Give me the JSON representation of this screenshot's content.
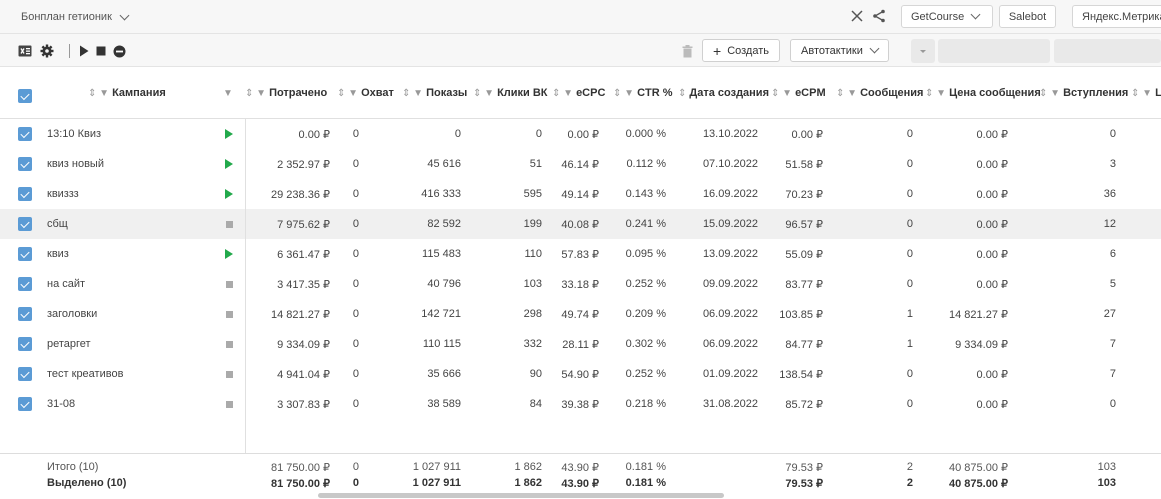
{
  "account": {
    "label": "Бонплан гетионик"
  },
  "top_buttons": [
    "GetCourse",
    "Salebot",
    "Яндекс.Метрика"
  ],
  "toolbar": {
    "create_label": "Создать",
    "autotactics_label": "Автотактики"
  },
  "columns": {
    "campaign": "Кампания",
    "spent": "Потрачено",
    "reach": "Охват",
    "impressions": "Показы",
    "clicks": "Клики ВК",
    "ecpc": "eCPC",
    "ctr": "CTR %",
    "created": "Дата создания",
    "ecpm": "eCPM",
    "messages": "Сообщения",
    "msg_price": "Цена сообщения",
    "joins": "Вступления",
    "extra": "L"
  },
  "rows": [
    {
      "name": "13:10 Квиз",
      "status": "play",
      "spent": "0.00 ₽",
      "reach": "0",
      "impressions": "0",
      "clicks": "0",
      "ecpc": "0.00 ₽",
      "ctr": "0.000 %",
      "created": "13.10.2022",
      "ecpm": "0.00 ₽",
      "messages": "0",
      "msg_price": "0.00 ₽",
      "joins": "0"
    },
    {
      "name": "квиз новый",
      "status": "play",
      "spent": "2 352.97 ₽",
      "reach": "0",
      "impressions": "45 616",
      "clicks": "51",
      "ecpc": "46.14 ₽",
      "ctr": "0.112 %",
      "created": "07.10.2022",
      "ecpm": "51.58 ₽",
      "messages": "0",
      "msg_price": "0.00 ₽",
      "joins": "3"
    },
    {
      "name": "квиззз",
      "status": "play",
      "spent": "29 238.36 ₽",
      "reach": "0",
      "impressions": "416 333",
      "clicks": "595",
      "ecpc": "49.14 ₽",
      "ctr": "0.143 %",
      "created": "16.09.2022",
      "ecpm": "70.23 ₽",
      "messages": "0",
      "msg_price": "0.00 ₽",
      "joins": "36"
    },
    {
      "name": "сбщ",
      "status": "stop",
      "spent": "7 975.62 ₽",
      "reach": "0",
      "impressions": "82 592",
      "clicks": "199",
      "ecpc": "40.08 ₽",
      "ctr": "0.241 %",
      "created": "15.09.2022",
      "ecpm": "96.57 ₽",
      "messages": "0",
      "msg_price": "0.00 ₽",
      "joins": "12"
    },
    {
      "name": "квиз",
      "status": "play",
      "spent": "6 361.47 ₽",
      "reach": "0",
      "impressions": "115 483",
      "clicks": "110",
      "ecpc": "57.83 ₽",
      "ctr": "0.095 %",
      "created": "13.09.2022",
      "ecpm": "55.09 ₽",
      "messages": "0",
      "msg_price": "0.00 ₽",
      "joins": "6"
    },
    {
      "name": "на сайт",
      "status": "stop",
      "spent": "3 417.35 ₽",
      "reach": "0",
      "impressions": "40 796",
      "clicks": "103",
      "ecpc": "33.18 ₽",
      "ctr": "0.252 %",
      "created": "09.09.2022",
      "ecpm": "83.77 ₽",
      "messages": "0",
      "msg_price": "0.00 ₽",
      "joins": "5"
    },
    {
      "name": "заголовки",
      "status": "stop",
      "spent": "14 821.27 ₽",
      "reach": "0",
      "impressions": "142 721",
      "clicks": "298",
      "ecpc": "49.74 ₽",
      "ctr": "0.209 %",
      "created": "06.09.2022",
      "ecpm": "103.85 ₽",
      "messages": "1",
      "msg_price": "14 821.27 ₽",
      "joins": "27"
    },
    {
      "name": "ретаргет",
      "status": "stop",
      "spent": "9 334.09 ₽",
      "reach": "0",
      "impressions": "110 115",
      "clicks": "332",
      "ecpc": "28.11 ₽",
      "ctr": "0.302 %",
      "created": "06.09.2022",
      "ecpm": "84.77 ₽",
      "messages": "1",
      "msg_price": "9 334.09 ₽",
      "joins": "7"
    },
    {
      "name": "тест креативов",
      "status": "stop",
      "spent": "4 941.04 ₽",
      "reach": "0",
      "impressions": "35 666",
      "clicks": "90",
      "ecpc": "54.90 ₽",
      "ctr": "0.252 %",
      "created": "01.09.2022",
      "ecpm": "138.54 ₽",
      "messages": "0",
      "msg_price": "0.00 ₽",
      "joins": "7"
    },
    {
      "name": "31-08",
      "status": "stop",
      "spent": "3 307.83 ₽",
      "reach": "0",
      "impressions": "38 589",
      "clicks": "84",
      "ecpc": "39.38 ₽",
      "ctr": "0.218 %",
      "created": "31.08.2022",
      "ecpm": "85.72 ₽",
      "messages": "0",
      "msg_price": "0.00 ₽",
      "joins": "0"
    }
  ],
  "totals": {
    "label": "Итого (10)",
    "spent": "81 750.00 ₽",
    "reach": "0",
    "impressions": "1 027 911",
    "clicks": "1 862",
    "ecpc": "43.90 ₽",
    "ctr": "0.181 %",
    "ecpm": "79.53 ₽",
    "messages": "2",
    "msg_price": "40 875.00 ₽",
    "joins": "103"
  },
  "selected": {
    "label": "Выделено (10)",
    "spent": "81 750.00 ₽",
    "reach": "0",
    "impressions": "1 027 911",
    "clicks": "1 862",
    "ecpc": "43.90 ₽",
    "ctr": "0.181 %",
    "ecpm": "79.53 ₽",
    "messages": "2",
    "msg_price": "40 875.00 ₽",
    "joins": "103"
  },
  "colors": {
    "checkbox": "#5b9bd5",
    "play": "#22a94b",
    "stop": "#aaaaaa",
    "alt_row": "#f0f0f0"
  }
}
